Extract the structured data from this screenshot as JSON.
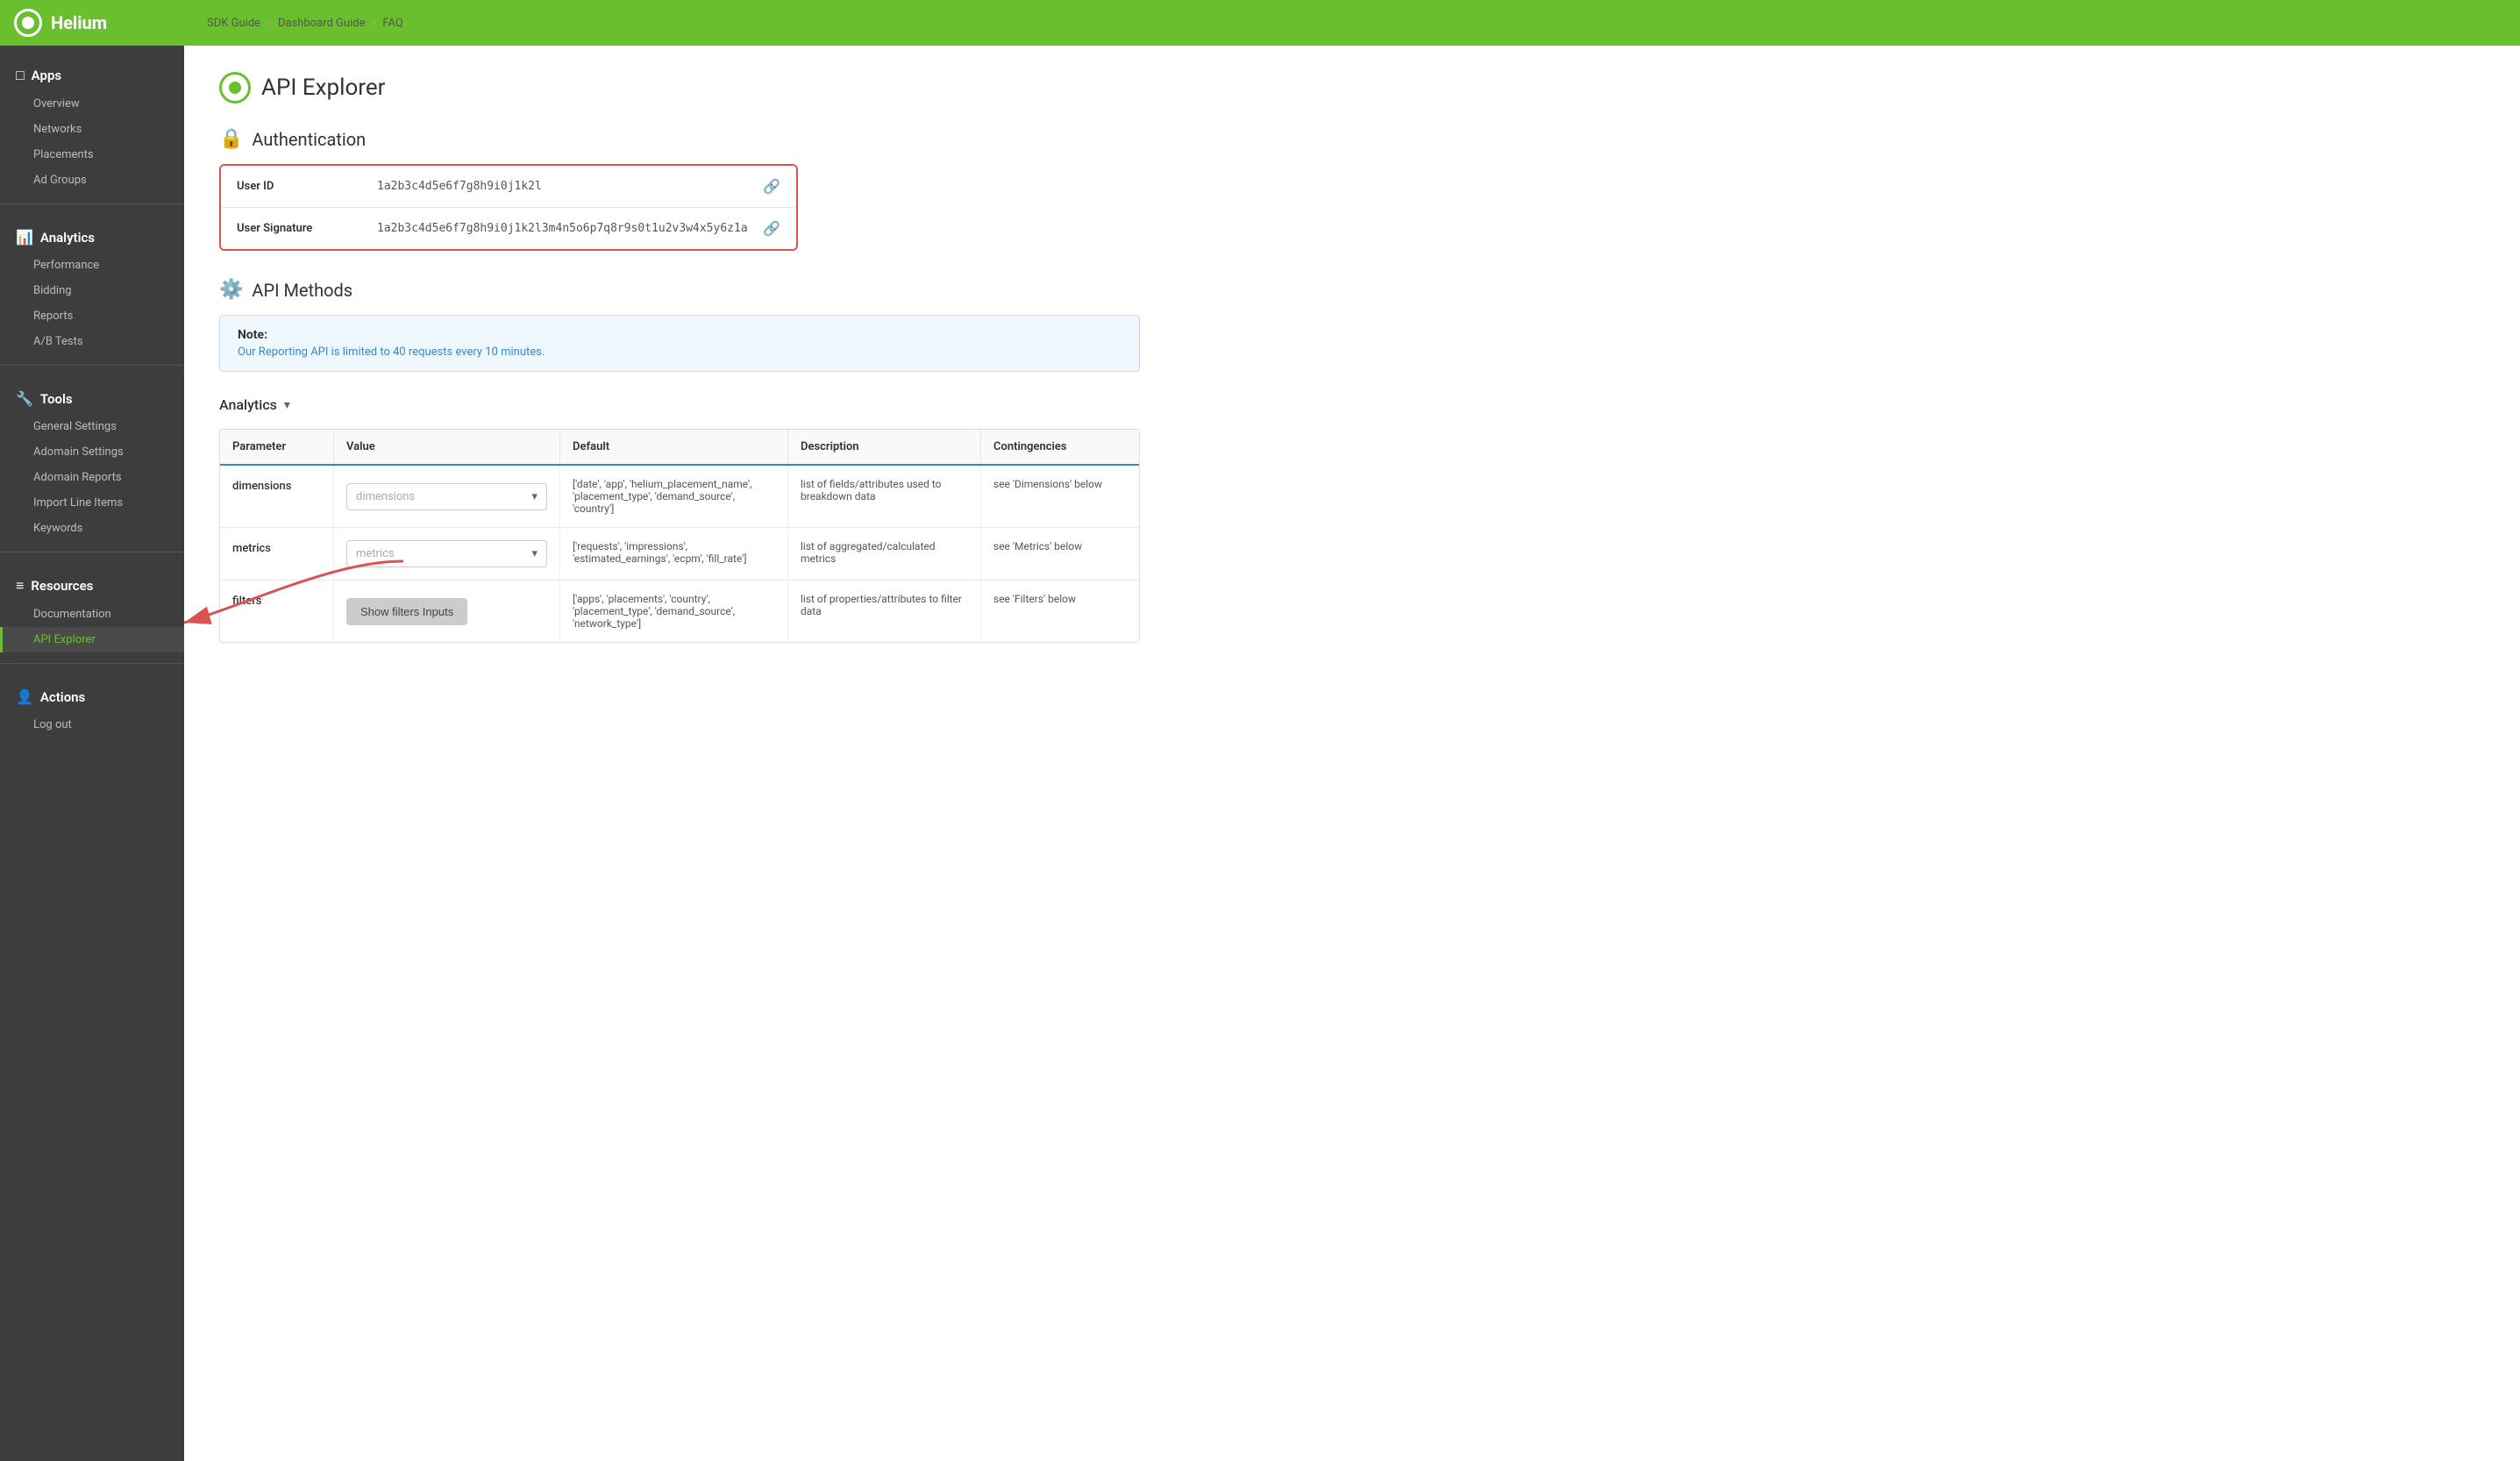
{
  "topbar": {
    "logo_text": "Helium",
    "breadcrumb": [
      "SDK Guide",
      "Dashboard Guide",
      "FAQ"
    ]
  },
  "sidebar": {
    "sections": [
      {
        "id": "apps",
        "icon": "📱",
        "label": "Apps",
        "items": [
          "Overview",
          "Networks",
          "Placements",
          "Ad Groups"
        ]
      },
      {
        "id": "analytics",
        "icon": "📊",
        "label": "Analytics",
        "items": [
          "Performance",
          "Bidding",
          "Reports",
          "A/B Tests"
        ]
      },
      {
        "id": "tools",
        "icon": "🔧",
        "label": "Tools",
        "items": [
          "General Settings",
          "Adomain Settings",
          "Adomain Reports",
          "Import Line Items",
          "Keywords"
        ]
      },
      {
        "id": "resources",
        "icon": "☰",
        "label": "Resources",
        "items": [
          "Documentation",
          "API Explorer"
        ]
      },
      {
        "id": "actions",
        "icon": "👤",
        "label": "Actions",
        "items": [
          "Log out"
        ]
      }
    ]
  },
  "main": {
    "page_title": "API Explorer",
    "sections": {
      "authentication": {
        "title": "Authentication",
        "user_id_label": "User ID",
        "user_id_value": "1a2b3c4d5e6f7g8h9i0j1k2l",
        "user_signature_label": "User Signature",
        "user_signature_value": "1a2b3c4d5e6f7g8h9i0j1k2l3m4n5o6p7q8r9s0t1u2v3w4x5y6z1a"
      },
      "api_methods": {
        "title": "API Methods",
        "note_label": "Note:",
        "note_text": "Our Reporting API is limited to 40 requests every 10 minutes.",
        "analytics_label": "Analytics",
        "table": {
          "headers": [
            "Parameter",
            "Value",
            "Default",
            "Description",
            "Contingencies"
          ],
          "rows": [
            {
              "param": "dimensions",
              "value_placeholder": "dimensions",
              "default": "['date', 'app', 'helium_placement_name', 'placement_type', 'demand_source', 'country']",
              "description": "list of fields/attributes used to breakdown data",
              "contingencies": "see 'Dimensions' below"
            },
            {
              "param": "metrics",
              "value_placeholder": "metrics",
              "default": "['requests', 'impressions', 'estimated_earnings', 'ecpm', 'fill_rate']",
              "description": "list of aggregated/calculated metrics",
              "contingencies": "see 'Metrics' below"
            },
            {
              "param": "filters",
              "value_button": "Show filters Inputs",
              "default": "['apps', 'placements', 'country', 'placement_type', 'demand_source', 'network_type']",
              "description": "list of properties/attributes to filter data",
              "contingencies": "see 'Filters' below"
            }
          ]
        }
      }
    }
  }
}
